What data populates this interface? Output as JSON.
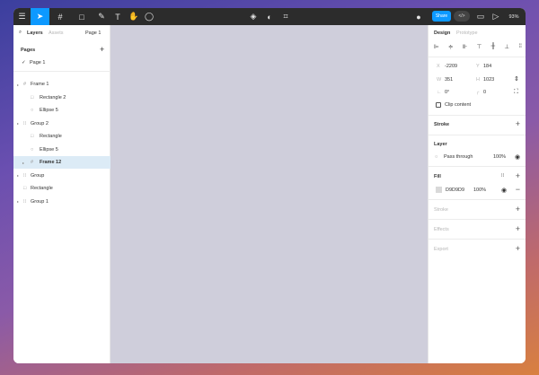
{
  "toolbar": {
    "zoom": "93%",
    "share": "Share"
  },
  "left": {
    "tab_layers": "Layers",
    "tab_assets": "Assets",
    "page_select": "Page 1",
    "pages_title": "Pages",
    "pages": [
      "Page 1"
    ],
    "layers": [
      {
        "name": "Frame 1",
        "type": "frame",
        "indent": 0,
        "caret": true
      },
      {
        "name": "Rectangle 2",
        "type": "rect",
        "indent": 1
      },
      {
        "name": "Ellipse 5",
        "type": "ellipse",
        "indent": 1
      },
      {
        "name": "Group 2",
        "type": "group",
        "indent": 0,
        "caret": true
      },
      {
        "name": "Rectangle",
        "type": "rect",
        "indent": 1
      },
      {
        "name": "Ellipse 5",
        "type": "ellipse",
        "indent": 1
      },
      {
        "name": "Frame 12",
        "type": "frame",
        "indent": 1,
        "caret": true,
        "selected": true
      },
      {
        "name": "Group",
        "type": "group",
        "indent": 0,
        "caret": true
      },
      {
        "name": "Rectangle",
        "type": "rect",
        "indent": 0
      },
      {
        "name": "Group 1",
        "type": "group",
        "indent": 0,
        "caret": true
      }
    ]
  },
  "right": {
    "tab_design": "Design",
    "tab_prototype": "Prototype",
    "x_label": "X",
    "x": "-2209",
    "y_label": "Y",
    "y": "184",
    "w_label": "W",
    "w": "351",
    "h_label": "H",
    "h": "1023",
    "rotation": "0°",
    "radius": "0",
    "clip": "Clip content",
    "stroke": "Stroke",
    "layer": "Layer",
    "blend": "Pass through",
    "layer_opacity": "100%",
    "fill": "Fill",
    "fill_hex": "D9D9D9",
    "fill_opacity": "100%",
    "stroke2": "Stroke",
    "effects": "Effects",
    "export": "Export"
  },
  "colors": {
    "accent": "#0d99ff",
    "toolbar": "#2c2c2c",
    "canvas": "#cfcedb",
    "fill": "#d9d9d9"
  }
}
